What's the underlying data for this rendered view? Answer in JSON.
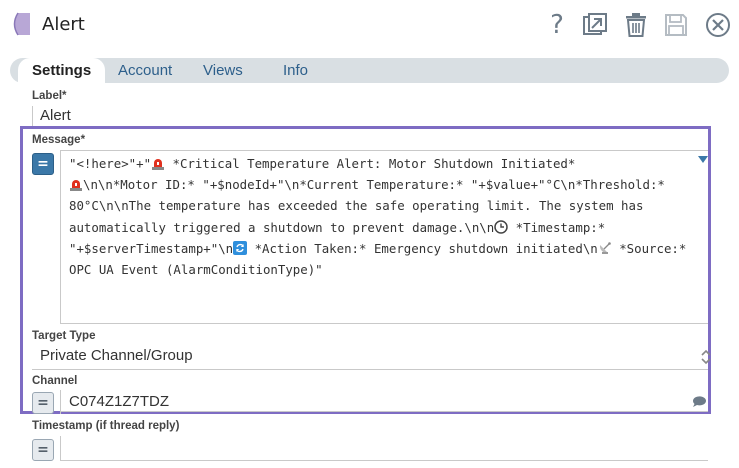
{
  "header": {
    "title": "Alert",
    "icons": [
      "help-icon",
      "export-icon",
      "delete-icon",
      "save-icon",
      "close-icon"
    ]
  },
  "tabs": [
    {
      "label": "Settings",
      "active": true
    },
    {
      "label": "Account",
      "active": false
    },
    {
      "label": "Views",
      "active": false
    },
    {
      "label": "Info",
      "active": false
    }
  ],
  "fields": {
    "label": {
      "name": "Label*",
      "value": "Alert"
    },
    "message": {
      "name": "Message*",
      "parts": {
        "p1": "\"<!here>\"+\"",
        "p2": " *Critical Temperature Alert: Motor Shutdown Initiated*",
        "p3": "\\n\\n*Motor ID:* \"+$nodeId+\"\\n*Current Temperature:* \"+$value+\"°C\\n*Threshold:* 80°C\\n\\nThe temperature has exceeded the safe operating limit. The system has automatically triggered a shutdown to prevent damage.\\n\\n",
        "p4": " *Timestamp:* \"+$serverTimestamp+\"\\n",
        "p5": " *Action Taken:* Emergency shutdown initiated\\n",
        "p6": " *Source:* OPC UA Event (AlarmConditionType)\""
      }
    },
    "target_type": {
      "name": "Target Type",
      "value": "Private Channel/Group"
    },
    "channel": {
      "name": "Channel",
      "value": "C074Z1Z7TDZ"
    },
    "timestamp": {
      "name": "Timestamp (if thread reply)",
      "value": ""
    }
  },
  "colors": {
    "highlight": "#7e6cc3",
    "tab_text": "#2d5f8b",
    "expr_active": "#3b78a8"
  }
}
